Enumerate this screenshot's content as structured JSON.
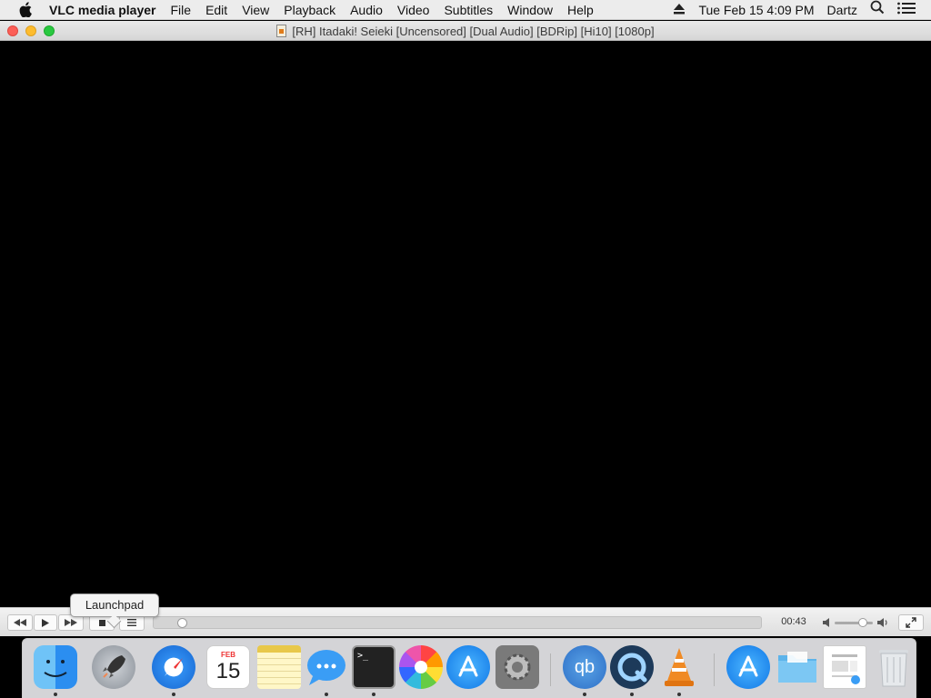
{
  "menubar": {
    "app_name": "VLC media player",
    "items": [
      "File",
      "Edit",
      "View",
      "Playback",
      "Audio",
      "Video",
      "Subtitles",
      "Window",
      "Help"
    ],
    "datetime": "Tue Feb 15  4:09 PM",
    "user": "Dartz"
  },
  "window": {
    "title": "[RH] Itadaki! Seieki [Uncensored] [Dual Audio] [BDRip] [Hi10] [1080p]"
  },
  "controls": {
    "elapsed": "00:43",
    "progress_fraction": 0.04,
    "volume_fraction": 0.8
  },
  "tooltip": {
    "text": "Launchpad"
  },
  "dock": {
    "calendar_month": "FEB",
    "calendar_day": "15",
    "qbittorrent_label": "qb",
    "terminal_prompt": ">_"
  },
  "colors": {
    "close": "#fc5f57",
    "minimize": "#fdbc2e",
    "maximize": "#29c840",
    "vlc_orange": "#f08a24"
  }
}
